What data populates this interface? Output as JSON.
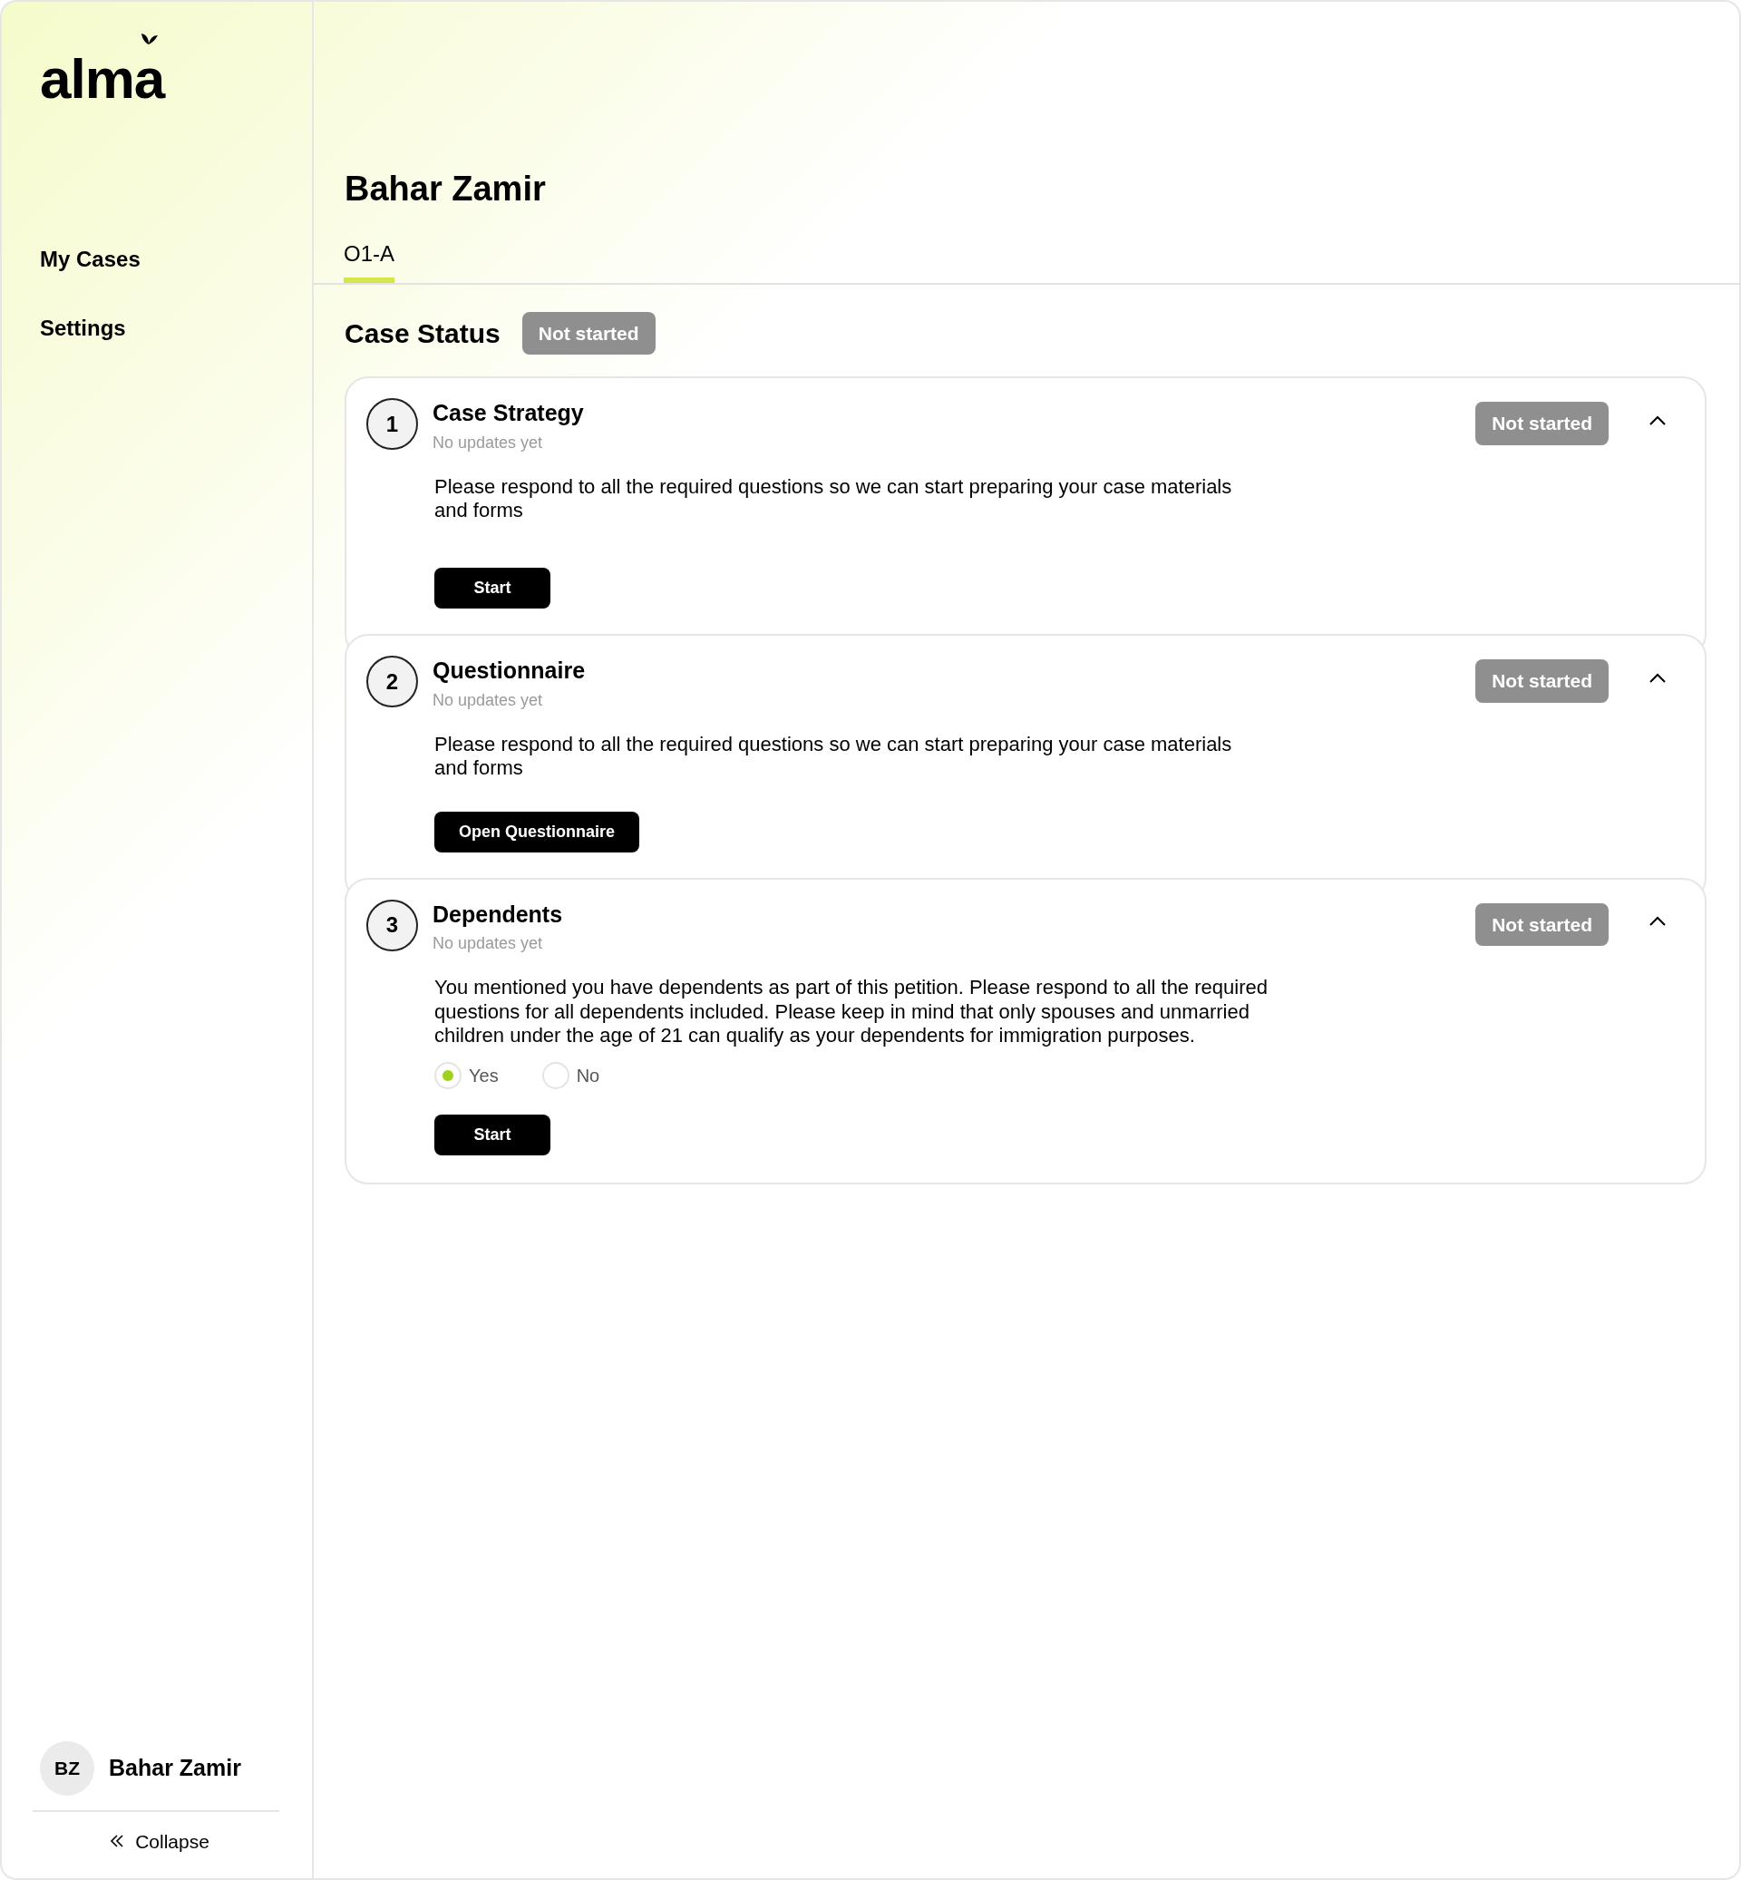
{
  "sidebar": {
    "logo": "alma",
    "nav": [
      {
        "label": "My Cases"
      },
      {
        "label": "Settings"
      }
    ],
    "user": {
      "initials": "BZ",
      "name": "Bahar Zamir"
    },
    "collapse": "Collapse"
  },
  "page": {
    "title": "Bahar Zamir",
    "tabs": [
      {
        "label": "O1-A",
        "selected": true
      }
    ]
  },
  "case_status": {
    "label": "Case Status",
    "status": "Not started"
  },
  "steps": [
    {
      "number": "1",
      "title": "Case Strategy",
      "subtitle": "No updates yet",
      "status": "Not started",
      "expanded": true,
      "description": "Please respond to all the required questions so we can start preparing your case materials and forms",
      "button": "Start"
    },
    {
      "number": "2",
      "title": "Questionnaire",
      "subtitle": "No updates yet",
      "status": "Not started",
      "expanded": true,
      "description": "Please respond to all the required questions so we can start preparing your case materials and forms",
      "button": "Open Questionnaire"
    },
    {
      "number": "3",
      "title": "Dependents",
      "subtitle": "No updates yet",
      "status": "Not started",
      "expanded": true,
      "description": "You mentioned you have dependents as part of this petition. Please respond to all the required questions for all dependents included. Please keep in mind that only spouses and unmarried children under the age of 21 can qualify as your dependents for immigration purposes.",
      "radios": [
        {
          "label": "Yes",
          "selected": true
        },
        {
          "label": "No",
          "selected": false
        }
      ],
      "button": "Start"
    }
  ]
}
